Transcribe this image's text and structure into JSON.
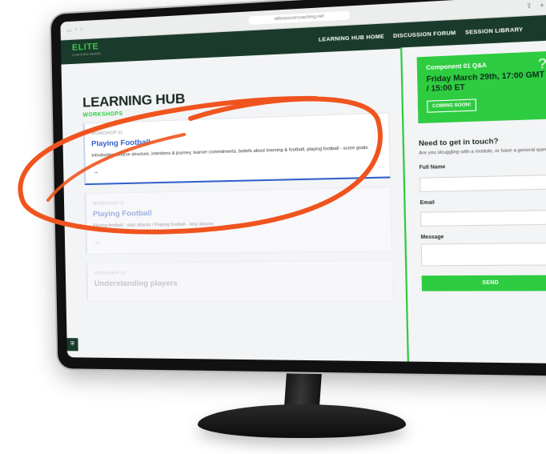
{
  "browser": {
    "url": "elitesoccercoaching.net"
  },
  "brand": {
    "name": "ELITE",
    "tagline": "COACHING AWARD"
  },
  "nav": {
    "links": [
      "LEARNING HUB HOME",
      "DISCUSSION FORUM",
      "SESSION LIBRARY"
    ]
  },
  "page": {
    "title": "LEARNING HUB",
    "section": "WORKSHOPS"
  },
  "workshops": [
    {
      "kicker": "WORKSHOP 01",
      "title": "Playing Football",
      "description": "Introduction, course structure, intentions & journey, learner commitments, beliefs about learning & football, playing football - score goals"
    },
    {
      "kicker": "WORKSHOP 02",
      "title": "Playing Football",
      "description": "Playing football - start attacks / Playing football - stop attacks"
    },
    {
      "kicker": "WORKSHOP 03",
      "title": "Understanding players",
      "description": ""
    }
  ],
  "promo": {
    "title": "Component 01 Q&A",
    "date": "Friday March 29th, 17:00 GMT / 15:00 ET",
    "button": "COMING SOON!"
  },
  "contact": {
    "heading": "Need to get in touch?",
    "subtext": "Are you struggling with a module, or have a general query...",
    "full_name_label": "Full Name",
    "email_label": "Email",
    "message_label": "Message",
    "send_label": "SEND"
  },
  "colors": {
    "accent_green": "#2ecc40",
    "nav_dark": "#1a3b2b",
    "link_blue": "#3361cc",
    "annotation_orange": "#f0541e"
  }
}
